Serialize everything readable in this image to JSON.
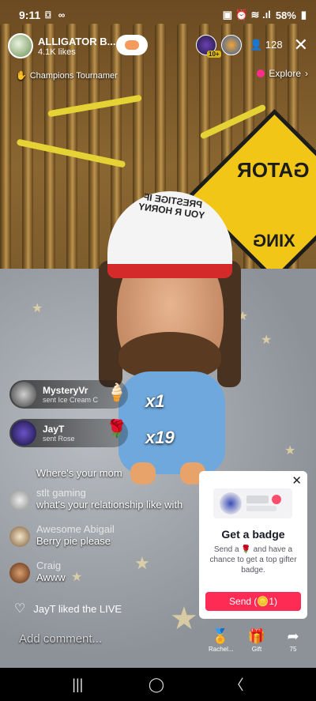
{
  "status_bar": {
    "time": "9:11",
    "left_icons": "⌼ ∞",
    "right_icons": "▣ ⏰ ≋ .ıl",
    "battery": "58%"
  },
  "host": {
    "name": "ALLIGATOR B...",
    "likes": "4.1K likes"
  },
  "viewers": {
    "count": "128",
    "badge": "10+"
  },
  "ranking": {
    "label": "Champions Tournamer"
  },
  "explore": {
    "label": "Explore"
  },
  "gifts": [
    {
      "user": "MysteryVr",
      "text": "sent Ice Cream C",
      "multiplier": "x1",
      "icon": "🍦"
    },
    {
      "user": "JayT",
      "text": "sent Rose",
      "multiplier": "x19",
      "icon": "🌹"
    }
  ],
  "chat": [
    {
      "user": "",
      "message": "Where's your mom"
    },
    {
      "user": "stlt gaming",
      "message": "what's your relationship like with"
    },
    {
      "user": "Awesome Abigail",
      "message": "Berry pie please"
    },
    {
      "user": "Craig",
      "message": "Awww"
    }
  ],
  "liked": {
    "text": "JayT liked the LIVE"
  },
  "badge_card": {
    "title": "Get a badge",
    "description": "Send a 🌹 and have a chance to get a top gifter badge.",
    "send_label": "Send (🪙1)"
  },
  "comment": {
    "placeholder": "Add comment..."
  },
  "bottom_actions": [
    {
      "label": "Rachel...",
      "icon": "🏅"
    },
    {
      "label": "Gift",
      "icon": "🎁"
    },
    {
      "label": "75",
      "icon": "➦"
    }
  ],
  "sign": {
    "line1": "GATOR",
    "line2": "XING"
  },
  "hat": {
    "text": "PRESTIGE IF YOU R HORNY"
  },
  "nav": {
    "recents": "|||",
    "home": "◯",
    "back": "〈"
  }
}
